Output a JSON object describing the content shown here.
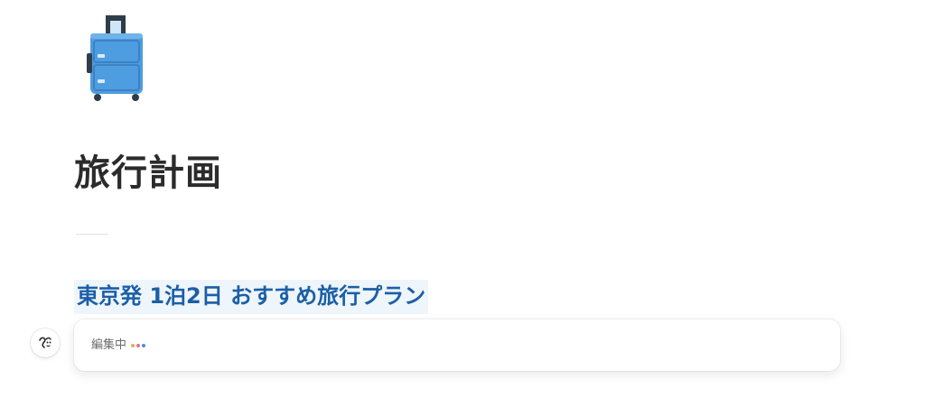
{
  "page": {
    "icon": "suitcase-icon",
    "title": "旅行計画"
  },
  "ai_block": {
    "heading": "東京発 1泊2日 おすすめ旅行プラン",
    "status_text": "編集中",
    "avatar_icon": "ai-face-icon",
    "dot_colors": [
      "#f2a64a",
      "#e56b9a",
      "#4a8fe0"
    ]
  },
  "colors": {
    "heading_text": "#1b5fa6",
    "heading_highlight": "#eef5fb",
    "suitcase": "#4e9de0"
  }
}
